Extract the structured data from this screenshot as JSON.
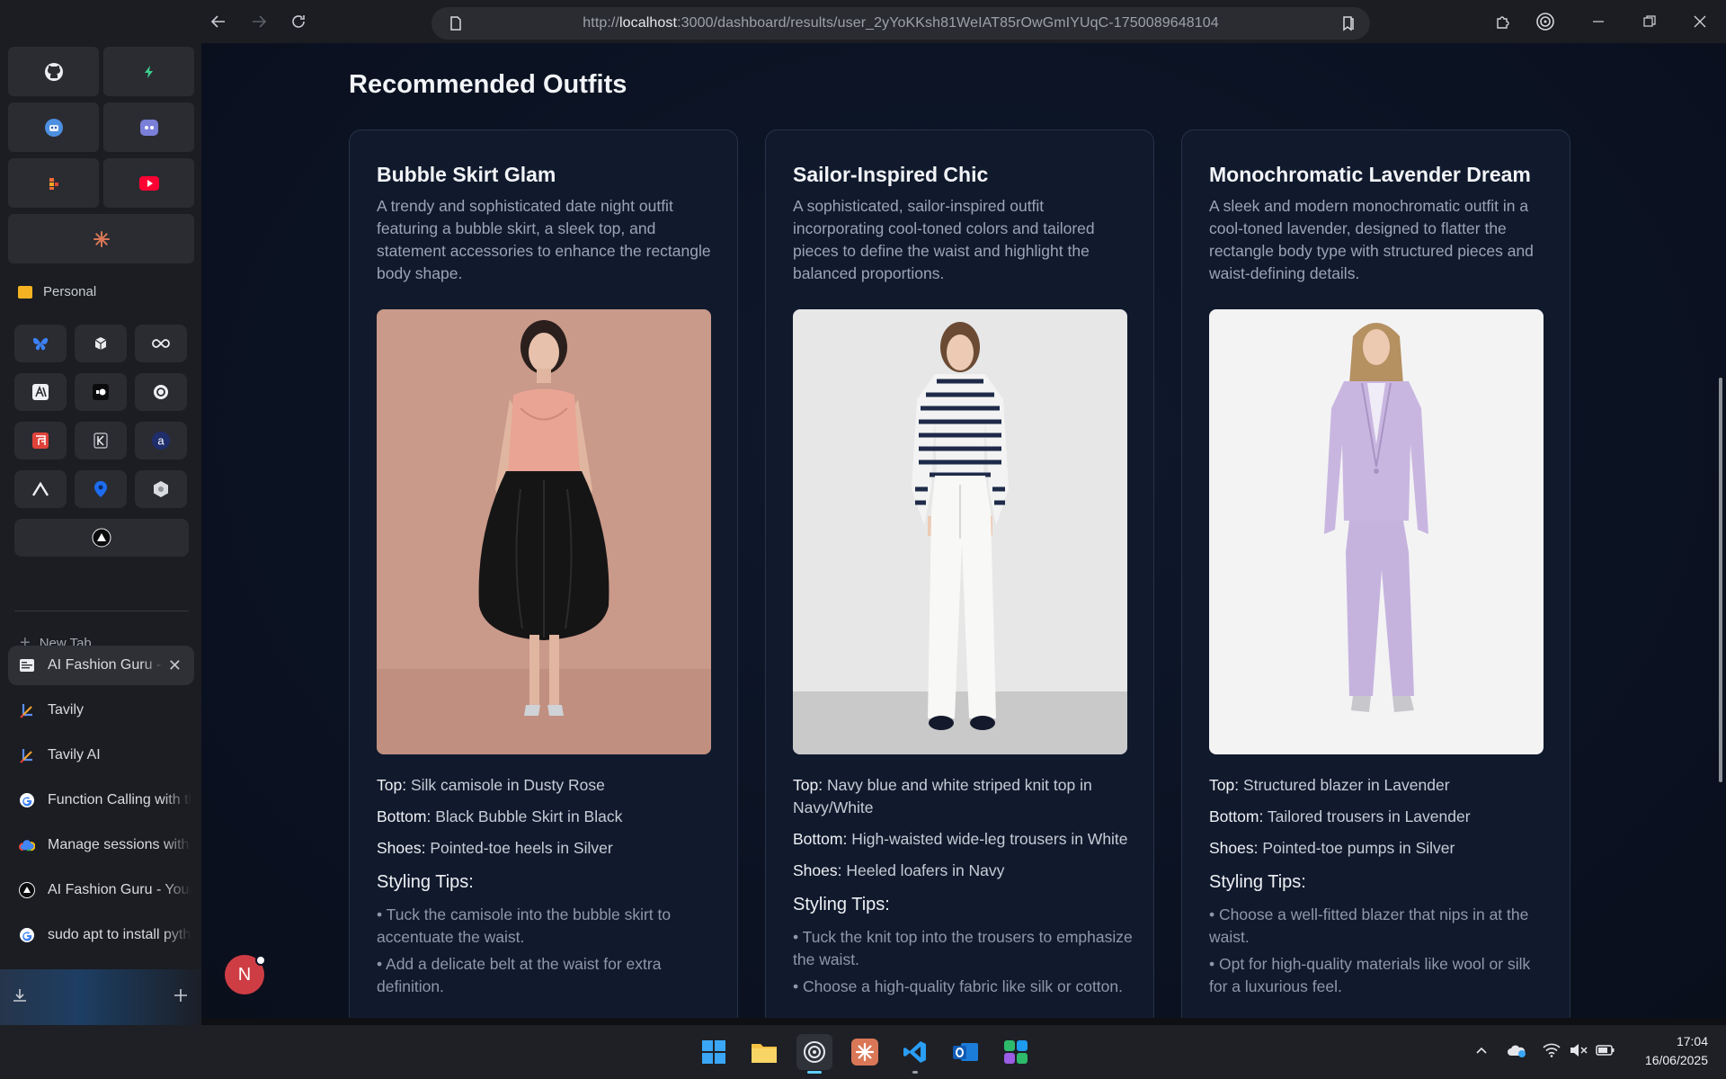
{
  "browser": {
    "url_prefix": "http://",
    "url_host": "localhost",
    "url_rest": ":3000/dashboard/results/user_2yYoKKsh81WeIAT85rOwGmIYUqC-1750089648104"
  },
  "sidebar": {
    "section_label": "Personal",
    "new_tab_label": "New Tab",
    "tabs": [
      {
        "label": "AI Fashion Guru - You",
        "active": true
      },
      {
        "label": "Tavily"
      },
      {
        "label": "Tavily AI"
      },
      {
        "label": "Function Calling with the Gemini API"
      },
      {
        "label": "Manage sessions with Vertex AI"
      },
      {
        "label": "AI Fashion Guru - Your AI stylist"
      },
      {
        "label": "sudo apt to install python"
      }
    ]
  },
  "page": {
    "title": "Recommended Outfits",
    "top_key": "Top:",
    "bottom_key": "Bottom:",
    "shoes_key": "Shoes:",
    "tips_heading": "Styling Tips:",
    "avatar_letter": "N"
  },
  "outfits": [
    {
      "title": "Bubble Skirt Glam",
      "description": "A trendy and sophisticated date night outfit featuring a bubble skirt, a sleek top, and statement accessories to enhance the rectangle body shape.",
      "top": "Silk camisole in Dusty Rose",
      "bottom": "Black Bubble Skirt in Black",
      "shoes": "Pointed-toe heels in Silver",
      "tips": [
        "• Tuck the camisole into the bubble skirt to accentuate the waist.",
        "• Add a delicate belt at the waist for extra definition."
      ]
    },
    {
      "title": "Sailor-Inspired Chic",
      "description": "A sophisticated, sailor-inspired outfit incorporating cool-toned colors and tailored pieces to define the waist and highlight the balanced proportions.",
      "top": "Navy blue and white striped knit top in Navy/White",
      "bottom": "High-waisted wide-leg trousers in White",
      "shoes": "Heeled loafers in Navy",
      "tips": [
        "• Tuck the knit top into the trousers to emphasize the waist.",
        "• Choose a high-quality fabric like silk or cotton."
      ]
    },
    {
      "title": "Monochromatic Lavender Dream",
      "description": "A sleek and modern monochromatic outfit in a cool-toned lavender, designed to flatter the rectangle body type with structured pieces and waist-defining details.",
      "top": "Structured blazer in Lavender",
      "bottom": "Tailored trousers in Lavender",
      "shoes": "Pointed-toe pumps in Silver",
      "tips": [
        "• Choose a well-fitted blazer that nips in at the waist.",
        "• Opt for high-quality materials like wool or silk for a luxurious feel."
      ]
    }
  ],
  "taskbar": {
    "time": "17:04",
    "date": "16/06/2025"
  },
  "colors": {
    "card_bg": "#111a2d",
    "page_bg": "#0b1222",
    "accent_blue": "#60cdff",
    "avatar_red": "#cf3d44"
  }
}
